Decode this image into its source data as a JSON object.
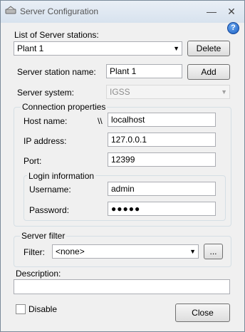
{
  "window": {
    "title": "Server Configuration",
    "minimize_glyph": "—",
    "close_glyph": "✕",
    "help_glyph": "?"
  },
  "servers": {
    "label": "List of Server stations:",
    "selected": "Plant 1",
    "delete_label": "Delete"
  },
  "station": {
    "name_label": "Server station name:",
    "name_value": "Plant 1",
    "add_label": "Add"
  },
  "system": {
    "label": "Server system:",
    "value": "IGSS"
  },
  "connection": {
    "title": "Connection properties",
    "host_label": "Host name:",
    "host_prefix": "\\\\",
    "host_value": "localhost",
    "ip_label": "IP address:",
    "ip_value": "127.0.0.1",
    "port_label": "Port:",
    "port_value": "12399"
  },
  "login": {
    "title": "Login information",
    "username_label": "Username:",
    "username_value": "admin",
    "password_label": "Password:",
    "password_mask": "●●●●●"
  },
  "filter": {
    "title": "Server filter",
    "label": "Filter:",
    "value": "<none>",
    "browse_label": "..."
  },
  "description": {
    "label": "Description:",
    "value": ""
  },
  "disable": {
    "label": "Disable",
    "checked": false
  },
  "close_label": "Close",
  "icons": {
    "dropdown": "chevron-down-icon",
    "app": "app-icon",
    "help": "help-icon"
  }
}
